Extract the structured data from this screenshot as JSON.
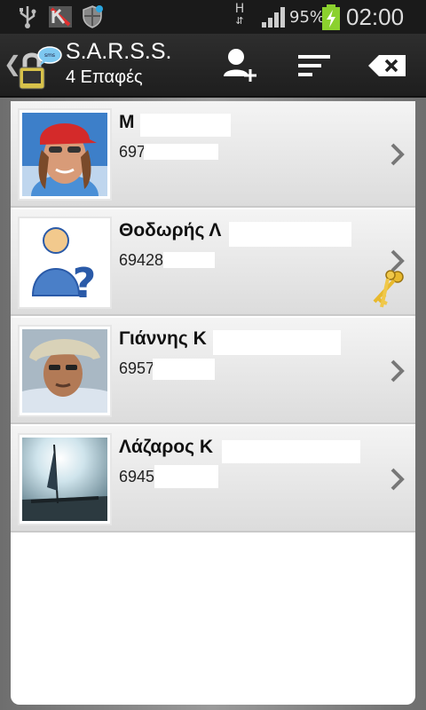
{
  "status_bar": {
    "battery": "95%",
    "time": "02:00",
    "network": "H",
    "icons": [
      "usb-icon",
      "missed-call-icon",
      "shield-icon",
      "signal-icon",
      "battery-charging-icon"
    ]
  },
  "action_bar": {
    "title": "S.A.R.S.S.",
    "subtitle": "4 Επαφές",
    "icons": [
      "back-chevron-icon",
      "lock-app-icon",
      "add-contact-icon",
      "sort-icon",
      "clear-icon"
    ]
  },
  "contacts": [
    {
      "name": "Μ",
      "phone": "697",
      "photo": "woman-red-cap"
    },
    {
      "name": "Θοδωρής Λ",
      "phone": "69428",
      "photo": "unknown-person-placeholder",
      "key_icon": "keys-icon"
    },
    {
      "name": "Γιάννης Κ",
      "phone": "6957",
      "photo": "man-bucket-hat"
    },
    {
      "name": "Λάζαρος Κ",
      "phone": "6945",
      "photo": "sailboat-sunset"
    }
  ],
  "colors": {
    "actionbar": "#1e1e1e",
    "statusbar": "#1a1a1a",
    "row_top": "#f4f4f4",
    "row_bottom": "#dcdcdc",
    "battery": "#8bd12e"
  }
}
